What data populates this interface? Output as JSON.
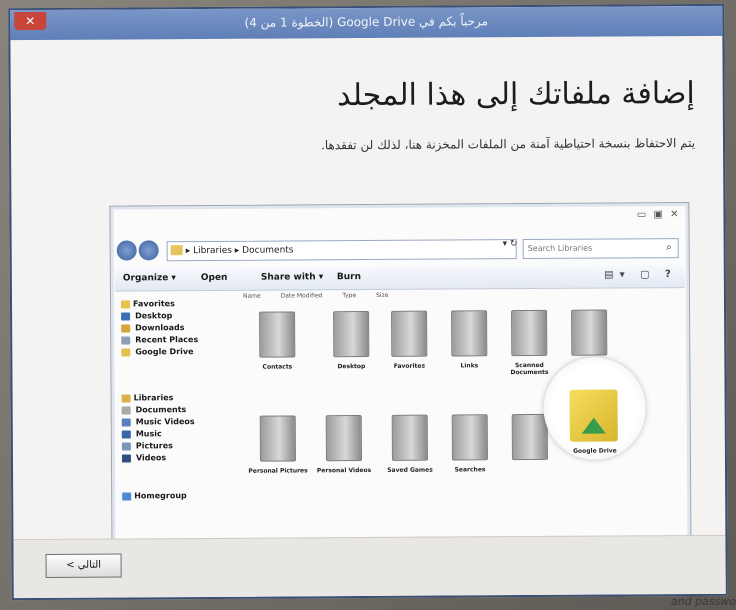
{
  "window": {
    "title": "مرحباً بكم في Google Drive (الخطوة 1 من 4)",
    "close_glyph": "✕"
  },
  "main": {
    "heading": "إضافة ملفاتك إلى هذا المجلد",
    "description": "يتم الاحتفاظ بنسخة احتياطية آمنة من الملفات المخزنة هنا، لذلك لن تفقدها."
  },
  "illustration": {
    "window_controls": "▭ ▣ ✕",
    "address": "▸ Libraries ▸ Documents",
    "search_placeholder": "Search Libraries",
    "refresh_glyph": "▾ ↻",
    "search_icon_glyph": "⌕",
    "toolbar": {
      "organize": "Organize ▾",
      "open": "Open",
      "share_with": "Share with ▾",
      "burn": "Burn",
      "right_icons": "▤▾ ▢ ?"
    },
    "column_headers": [
      "Name",
      "Date Modified",
      "Type",
      "Size"
    ],
    "favorites": {
      "header": "Favorites",
      "items": [
        "Desktop",
        "Downloads",
        "Recent Places",
        "Google Drive"
      ]
    },
    "libraries": {
      "header": "Libraries",
      "items": [
        "Documents",
        "Music Videos",
        "Music",
        "Pictures",
        "Videos"
      ]
    },
    "homegroup": "Homegroup",
    "files": [
      "Contacts",
      "Desktop",
      "Favorites",
      "Links",
      "Scanned Documents",
      "Personal Pictures",
      "Personal Videos",
      "Saved Games",
      "Searches",
      "Google Drive"
    ]
  },
  "footer": {
    "next_label": "التالي >",
    "partial_caption": "and passwo"
  }
}
